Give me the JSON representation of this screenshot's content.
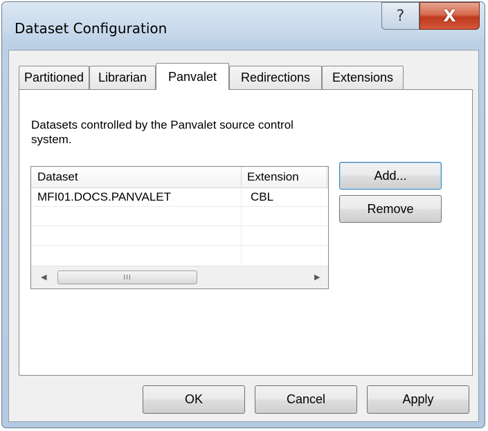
{
  "window": {
    "title": "Dataset Configuration"
  },
  "titlebar_buttons": {
    "help_glyph": "?",
    "close_glyph": "X"
  },
  "tabs": [
    {
      "label": "Partitioned",
      "active": false
    },
    {
      "label": "Librarian",
      "active": false
    },
    {
      "label": "Panvalet",
      "active": true
    },
    {
      "label": "Redirections",
      "active": false
    },
    {
      "label": "Extensions",
      "active": false
    }
  ],
  "panel": {
    "description": "Datasets controlled by the Panvalet source control system."
  },
  "listview": {
    "columns": [
      "Dataset",
      "Extension"
    ],
    "rows": [
      [
        "MFI01.DOCS.PANVALET",
        "CBL"
      ],
      [
        "",
        ""
      ],
      [
        "",
        ""
      ],
      [
        "",
        ""
      ]
    ],
    "scrollbar": {
      "left_arrow": "◀",
      "right_arrow": "▶",
      "grip": "III"
    }
  },
  "buttons": {
    "add": "Add...",
    "remove": "Remove",
    "ok": "OK",
    "cancel": "Cancel",
    "apply": "Apply"
  },
  "colors": {
    "frame": "#c9daec",
    "close": "#c0391d",
    "client": "#f0f0f0",
    "focus_border": "#3c7fb1"
  }
}
